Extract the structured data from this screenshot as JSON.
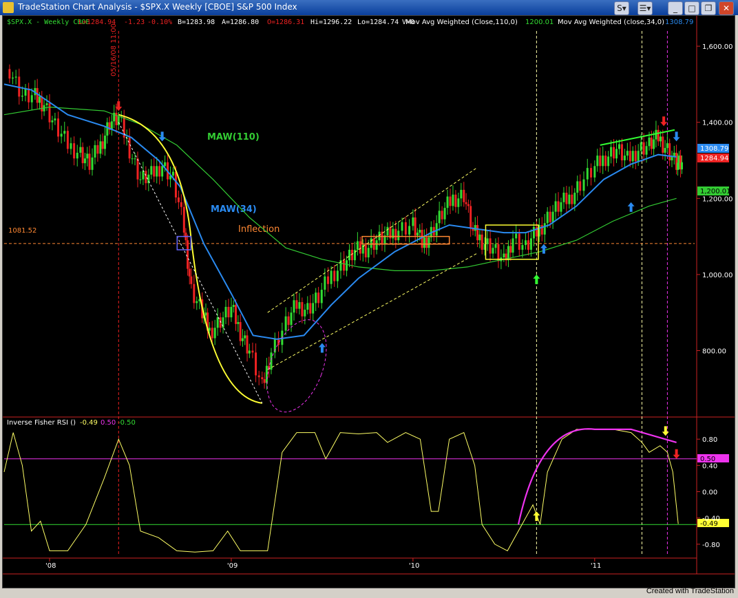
{
  "window": {
    "title": "TradeStation Chart Analysis - $SPX.X Weekly [CBOE] S&P 500 Index",
    "footer": "Created with TradeStation"
  },
  "header": {
    "symbol_info": "$SPX.X - Weekly CBOE",
    "last": "L=1284.94",
    "change": "-1.23",
    "pct": "-0.10%",
    "bid": "B=1283.98",
    "ask": "A=1286.80",
    "open": "O=1286.31",
    "high": "Hi=1296.22",
    "low": "Lo=1284.74",
    "vol": "V=0",
    "ma110_label": "Mov Avg Weighted (Close,110,0)",
    "ma110_value": "1200.01",
    "ma34_label": "Mov Avg Weighted (close,34,0)",
    "ma34_value": "1308.79"
  },
  "colors": {
    "background": "#000000",
    "bull": "#33dd33",
    "bear": "#ee2222",
    "ma34": "#2a8af0",
    "ma110": "#33cc33",
    "fisher": "#ffff66",
    "magenta": "#ee33ee",
    "inflection": "#ff8833"
  },
  "annotations": {
    "vline_date": "05/16/08 11:00",
    "maw110": "MAW(110)",
    "maw34": "MAW(34)",
    "inflection": "Inflection",
    "inflection_price": "1081.52"
  },
  "price_tags": {
    "ma34": "1308.79",
    "last": "1284.94",
    "ma110": "1,200.01"
  },
  "indicator": {
    "label": "Inverse Fisher RSI ()",
    "v1": "-0.49",
    "v2": "0.50",
    "v3": "-0.50",
    "tag_upper": "0.50",
    "tag_value": "-0.49"
  },
  "chart_data": [
    {
      "type": "candlestick",
      "title": "$SPX.X - Weekly CBOE",
      "ylim": [
        640,
        1640
      ],
      "y_ticks": [
        "1,600.00",
        "1,400.00",
        "1,200.00",
        "1,000.00",
        "800.00"
      ],
      "y_tick_values": [
        1600,
        1400,
        1200,
        1000,
        800
      ],
      "x_ticks": [
        "'08",
        "'09",
        "'10",
        "'11"
      ],
      "x_tick_values": [
        2008.0,
        2009.0,
        2010.0,
        2011.0
      ],
      "xlim": [
        2007.75,
        2011.55
      ],
      "close_series_approx": [
        [
          2007.78,
          1540
        ],
        [
          2007.85,
          1470
        ],
        [
          2007.92,
          1465
        ],
        [
          2007.97,
          1450
        ],
        [
          2008.03,
          1390
        ],
        [
          2008.1,
          1340
        ],
        [
          2008.17,
          1320
        ],
        [
          2008.22,
          1290
        ],
        [
          2008.28,
          1340
        ],
        [
          2008.33,
          1400
        ],
        [
          2008.38,
          1410
        ],
        [
          2008.44,
          1330
        ],
        [
          2008.5,
          1250
        ],
        [
          2008.56,
          1260
        ],
        [
          2008.62,
          1290
        ],
        [
          2008.68,
          1250
        ],
        [
          2008.74,
          1120
        ],
        [
          2008.78,
          960
        ],
        [
          2008.84,
          900
        ],
        [
          2008.88,
          850
        ],
        [
          2008.94,
          880
        ],
        [
          2009.0,
          910
        ],
        [
          2009.05,
          850
        ],
        [
          2009.1,
          800
        ],
        [
          2009.17,
          700
        ],
        [
          2009.22,
          800
        ],
        [
          2009.3,
          870
        ],
        [
          2009.36,
          920
        ],
        [
          2009.42,
          910
        ],
        [
          2009.48,
          940
        ],
        [
          2009.55,
          1000
        ],
        [
          2009.62,
          1030
        ],
        [
          2009.68,
          1060
        ],
        [
          2009.74,
          1070
        ],
        [
          2009.8,
          1090
        ],
        [
          2009.86,
          1100
        ],
        [
          2009.92,
          1120
        ],
        [
          2010.0,
          1130
        ],
        [
          2010.05,
          1080
        ],
        [
          2010.1,
          1110
        ],
        [
          2010.16,
          1160
        ],
        [
          2010.22,
          1200
        ],
        [
          2010.28,
          1210
        ],
        [
          2010.33,
          1110
        ],
        [
          2010.38,
          1090
        ],
        [
          2010.44,
          1070
        ],
        [
          2010.5,
          1030
        ],
        [
          2010.55,
          1100
        ],
        [
          2010.62,
          1070
        ],
        [
          2010.68,
          1110
        ],
        [
          2010.74,
          1150
        ],
        [
          2010.8,
          1180
        ],
        [
          2010.86,
          1200
        ],
        [
          2010.92,
          1240
        ],
        [
          2011.0,
          1280
        ],
        [
          2011.06,
          1310
        ],
        [
          2011.12,
          1330
        ],
        [
          2011.18,
          1300
        ],
        [
          2011.24,
          1330
        ],
        [
          2011.3,
          1340
        ],
        [
          2011.35,
          1360
        ],
        [
          2011.4,
          1330
        ],
        [
          2011.45,
          1290
        ],
        [
          2011.48,
          1285
        ]
      ],
      "series": [
        {
          "name": "Mov Avg Weighted (close,34,0)",
          "points": [
            [
              2007.75,
              1500
            ],
            [
              2007.9,
              1485
            ],
            [
              2008.1,
              1420
            ],
            [
              2008.3,
              1390
            ],
            [
              2008.45,
              1360
            ],
            [
              2008.6,
              1300
            ],
            [
              2008.72,
              1230
            ],
            [
              2008.85,
              1080
            ],
            [
              2009.0,
              950
            ],
            [
              2009.12,
              840
            ],
            [
              2009.25,
              830
            ],
            [
              2009.4,
              840
            ],
            [
              2009.55,
              920
            ],
            [
              2009.7,
              990
            ],
            [
              2009.9,
              1060
            ],
            [
              2010.1,
              1110
            ],
            [
              2010.2,
              1130
            ],
            [
              2010.35,
              1120
            ],
            [
              2010.5,
              1110
            ],
            [
              2010.62,
              1110
            ],
            [
              2010.75,
              1130
            ],
            [
              2010.9,
              1180
            ],
            [
              2011.05,
              1250
            ],
            [
              2011.2,
              1290
            ],
            [
              2011.35,
              1315
            ],
            [
              2011.45,
              1309
            ]
          ]
        },
        {
          "name": "Mov Avg Weighted (Close,110,0)",
          "points": [
            [
              2007.75,
              1420
            ],
            [
              2008.0,
              1440
            ],
            [
              2008.3,
              1430
            ],
            [
              2008.5,
              1395
            ],
            [
              2008.7,
              1340
            ],
            [
              2008.9,
              1250
            ],
            [
              2009.1,
              1150
            ],
            [
              2009.3,
              1070
            ],
            [
              2009.5,
              1040
            ],
            [
              2009.7,
              1020
            ],
            [
              2009.9,
              1010
            ],
            [
              2010.1,
              1010
            ],
            [
              2010.3,
              1020
            ],
            [
              2010.5,
              1040
            ],
            [
              2010.7,
              1060
            ],
            [
              2010.9,
              1090
            ],
            [
              2011.1,
              1140
            ],
            [
              2011.3,
              1180
            ],
            [
              2011.45,
              1200
            ]
          ]
        }
      ],
      "horizontal_lines": [
        {
          "label": "1081.52",
          "value": 1081.52
        }
      ]
    },
    {
      "type": "line",
      "title": "Inverse Fisher RSI ()",
      "ylim": [
        -0.98,
        0.98
      ],
      "y_ticks": [
        "0.80",
        "0.40",
        "0.00",
        "-0.40",
        "-0.80"
      ],
      "y_tick_values": [
        0.8,
        0.4,
        0.0,
        -0.4,
        -0.8
      ],
      "xlim": [
        2007.75,
        2011.55
      ],
      "levels": [
        0.5,
        -0.5
      ],
      "series": [
        {
          "name": "Inverse Fisher RSI",
          "points": [
            [
              2007.75,
              0.3
            ],
            [
              2007.8,
              0.9
            ],
            [
              2007.85,
              0.4
            ],
            [
              2007.9,
              -0.6
            ],
            [
              2007.95,
              -0.45
            ],
            [
              2008.0,
              -0.9
            ],
            [
              2008.1,
              -0.9
            ],
            [
              2008.2,
              -0.5
            ],
            [
              2008.3,
              0.2
            ],
            [
              2008.38,
              0.8
            ],
            [
              2008.44,
              0.4
            ],
            [
              2008.5,
              -0.6
            ],
            [
              2008.6,
              -0.7
            ],
            [
              2008.7,
              -0.9
            ],
            [
              2008.8,
              -0.92
            ],
            [
              2008.9,
              -0.9
            ],
            [
              2008.98,
              -0.6
            ],
            [
              2009.05,
              -0.9
            ],
            [
              2009.2,
              -0.9
            ],
            [
              2009.28,
              0.6
            ],
            [
              2009.36,
              0.9
            ],
            [
              2009.46,
              0.9
            ],
            [
              2009.52,
              0.5
            ],
            [
              2009.6,
              0.9
            ],
            [
              2009.7,
              0.88
            ],
            [
              2009.8,
              0.9
            ],
            [
              2009.86,
              0.75
            ],
            [
              2009.96,
              0.9
            ],
            [
              2010.04,
              0.8
            ],
            [
              2010.1,
              -0.3
            ],
            [
              2010.14,
              -0.3
            ],
            [
              2010.2,
              0.8
            ],
            [
              2010.28,
              0.9
            ],
            [
              2010.34,
              0.4
            ],
            [
              2010.38,
              -0.5
            ],
            [
              2010.45,
              -0.8
            ],
            [
              2010.52,
              -0.9
            ],
            [
              2010.6,
              -0.5
            ],
            [
              2010.66,
              -0.2
            ],
            [
              2010.7,
              -0.5
            ],
            [
              2010.74,
              0.3
            ],
            [
              2010.82,
              0.8
            ],
            [
              2010.9,
              0.95
            ],
            [
              2011.0,
              0.95
            ],
            [
              2011.1,
              0.95
            ],
            [
              2011.2,
              0.9
            ],
            [
              2011.26,
              0.75
            ],
            [
              2011.3,
              0.6
            ],
            [
              2011.36,
              0.7
            ],
            [
              2011.4,
              0.6
            ],
            [
              2011.43,
              0.3
            ],
            [
              2011.46,
              -0.49
            ]
          ]
        }
      ]
    }
  ]
}
